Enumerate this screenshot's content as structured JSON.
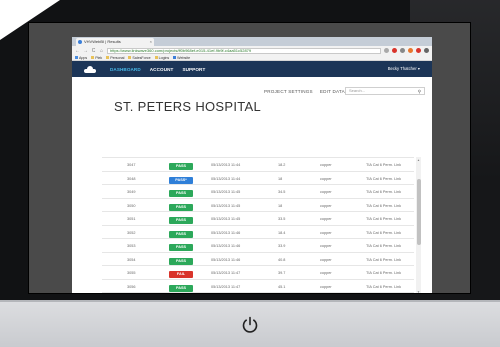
{
  "browser": {
    "tab_title": "VHVWebBI | Results",
    "tab_close": "×",
    "nav_back": "←",
    "nav_forward": "→",
    "nav_reload": "C",
    "nav_home": "⌂",
    "url": "https://www.linkwave360.com/projects/ff0b968ef-e015-41ef-9b9f-c4aa51c52879",
    "bookmarks": [
      "Apps",
      "Plek",
      "Personal",
      "SalesForce",
      "Logins",
      "Website"
    ]
  },
  "app_nav": {
    "items": [
      {
        "label": "DASHBOARD",
        "active": true
      },
      {
        "label": "ACCOUNT",
        "active": false
      },
      {
        "label": "SUPPORT",
        "active": false
      }
    ],
    "user": "Becky Thatcher ▾"
  },
  "toolbar": {
    "project_settings": "PROJECT SETTINGS",
    "edit_data": "EDIT DATA",
    "search_placeholder": "Search..."
  },
  "page_title": "ST. PETERS HOSPITAL",
  "rows": [
    {
      "id": "3047",
      "status": "PASS",
      "date": "05/13/2013 11:44",
      "value": "18.2",
      "material": "copper",
      "procedure": "TIA Cat 6 Perm. Link"
    },
    {
      "id": "3048",
      "status": "PASS*",
      "date": "05/13/2013 11:44",
      "value": "18",
      "material": "copper",
      "procedure": "TIA Cat 6 Perm. Link"
    },
    {
      "id": "3049",
      "status": "PASS",
      "date": "05/13/2013 11:45",
      "value": "34.5",
      "material": "copper",
      "procedure": "TIA Cat 6 Perm. Link"
    },
    {
      "id": "3050",
      "status": "PASS",
      "date": "05/13/2013 11:45",
      "value": "18",
      "material": "copper",
      "procedure": "TIA Cat 6 Perm. Link"
    },
    {
      "id": "3051",
      "status": "PASS",
      "date": "05/13/2013 11:45",
      "value": "33.5",
      "material": "copper",
      "procedure": "TIA Cat 6 Perm. Link"
    },
    {
      "id": "3052",
      "status": "PASS",
      "date": "05/13/2013 11:46",
      "value": "18.4",
      "material": "copper",
      "procedure": "TIA Cat 6 Perm. Link"
    },
    {
      "id": "3053",
      "status": "PASS",
      "date": "05/13/2013 11:46",
      "value": "33.9",
      "material": "copper",
      "procedure": "TIA Cat 6 Perm. Link"
    },
    {
      "id": "3054",
      "status": "PASS",
      "date": "05/13/2013 11:46",
      "value": "40.8",
      "material": "copper",
      "procedure": "TIA Cat 6 Perm. Link"
    },
    {
      "id": "3055",
      "status": "FAIL",
      "date": "05/13/2013 11:47",
      "value": "39.7",
      "material": "copper",
      "procedure": "TIA Cat 6 Perm. Link"
    },
    {
      "id": "3056",
      "status": "PASS",
      "date": "05/13/2013 11:47",
      "value": "45.1",
      "material": "copper",
      "procedure": "TIA Cat 6 Perm. Link"
    },
    {
      "id": "3057",
      "status": "PASS",
      "date": "05/13/2013 11:48",
      "value": "41.2",
      "material": "copper",
      "procedure": "TIA Cat 6 Perm. Link"
    }
  ],
  "colors": {
    "pass": "#2ca85a",
    "pass_star": "#2f7fd8",
    "fail": "#d9342b",
    "nav_bg": "#1c3557",
    "nav_active": "#46b8e8"
  },
  "icons": {
    "logo": "cloud-logo-icon",
    "power": "power-icon",
    "search": "search-icon"
  }
}
